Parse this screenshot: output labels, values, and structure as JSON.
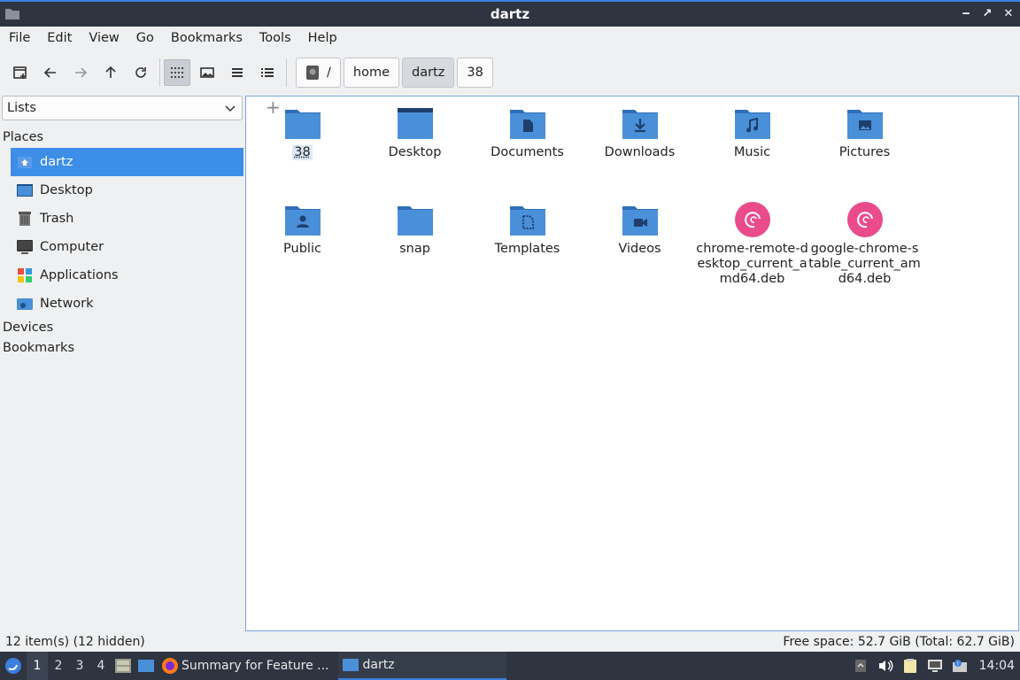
{
  "window": {
    "title": "dartz"
  },
  "menu": [
    "File",
    "Edit",
    "View",
    "Go",
    "Bookmarks",
    "Tools",
    "Help"
  ],
  "breadcrumb": {
    "root": "/",
    "items": [
      "home",
      "dartz",
      "38"
    ]
  },
  "sidebar": {
    "lists_label": "Lists",
    "places_header": "Places",
    "places": [
      {
        "label": "dartz",
        "icon": "home-icon"
      },
      {
        "label": "Desktop",
        "icon": "desktop-icon"
      },
      {
        "label": "Trash",
        "icon": "trash-icon"
      },
      {
        "label": "Computer",
        "icon": "computer-icon"
      },
      {
        "label": "Applications",
        "icon": "applications-icon"
      },
      {
        "label": "Network",
        "icon": "network-icon"
      }
    ],
    "devices_header": "Devices",
    "bookmarks_header": "Bookmarks"
  },
  "files": [
    {
      "name": "38",
      "icon": "folder-icon"
    },
    {
      "name": "Desktop",
      "icon": "desktop-folder-icon"
    },
    {
      "name": "Documents",
      "icon": "documents-folder-icon"
    },
    {
      "name": "Downloads",
      "icon": "downloads-folder-icon"
    },
    {
      "name": "Music",
      "icon": "music-folder-icon"
    },
    {
      "name": "Pictures",
      "icon": "pictures-folder-icon"
    },
    {
      "name": "Public",
      "icon": "public-folder-icon"
    },
    {
      "name": "snap",
      "icon": "folder-icon"
    },
    {
      "name": "Templates",
      "icon": "templates-folder-icon"
    },
    {
      "name": "Videos",
      "icon": "videos-folder-icon"
    },
    {
      "name": "chrome-remote-desktop_current_amd64.deb",
      "icon": "debian-package-icon"
    },
    {
      "name": "google-chrome-stable_current_amd64.deb",
      "icon": "debian-package-icon"
    }
  ],
  "status": {
    "items": "12 item(s) (12 hidden)",
    "free_space": "Free space: 52.7 GiB (Total: 62.7 GiB)"
  },
  "taskbar": {
    "workspaces": [
      "1",
      "2",
      "3",
      "4"
    ],
    "tasks": [
      {
        "label": "Summary for Feature ...",
        "icon": "firefox-icon"
      },
      {
        "label": "dartz",
        "icon": "folder-icon"
      }
    ],
    "clock": "14:04"
  },
  "colors": {
    "accent": "#3d8ee6",
    "folder": "#4a90d9",
    "taskbar": "#2e3440"
  }
}
